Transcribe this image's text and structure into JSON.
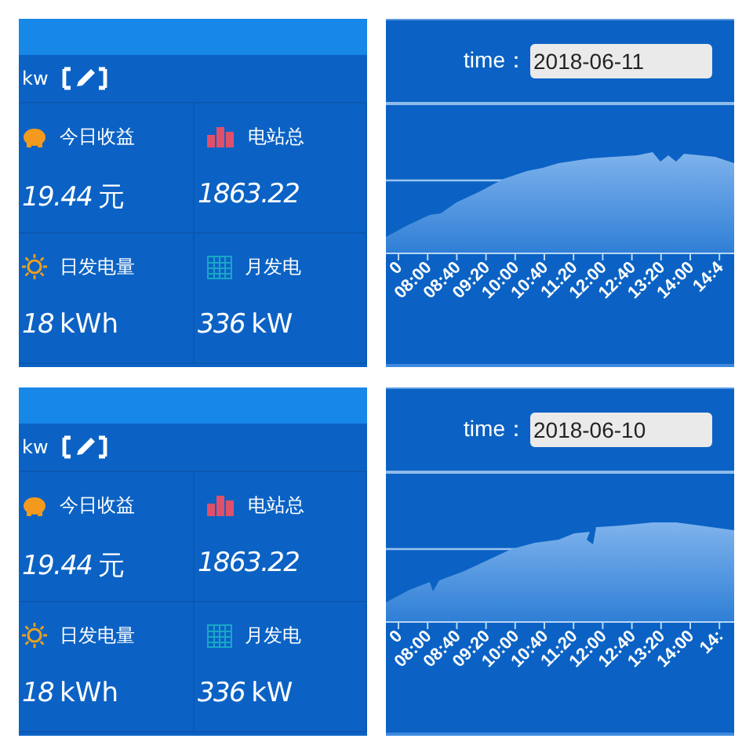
{
  "panels": [
    {
      "kind": "stats",
      "power_unit": "kw",
      "stats": [
        {
          "label": "今日收益",
          "value": "19.44",
          "unit": "元"
        },
        {
          "label": "电站总",
          "value": "1863.22"
        },
        {
          "label": "日发电量",
          "value": "18",
          "unit": "kWh"
        },
        {
          "label": "月发电",
          "value": "336",
          "unit": "kW"
        }
      ]
    },
    {
      "kind": "chart",
      "time_label": "time：",
      "date": "2018-06-11",
      "x_tick_labels": [
        "0",
        "08:00",
        "08:40",
        "09:20",
        "10:00",
        "10:40",
        "11:20",
        "12:00",
        "12:40",
        "13:20",
        "14:00",
        "14:4"
      ]
    },
    {
      "kind": "stats",
      "power_unit": "kw",
      "stats": [
        {
          "label": "今日收益",
          "value": "19.44",
          "unit": "元"
        },
        {
          "label": "电站总",
          "value": "1863.22"
        },
        {
          "label": "日发电量",
          "value": "18",
          "unit": "kWh"
        },
        {
          "label": "月发电",
          "value": "336",
          "unit": "kW"
        }
      ]
    },
    {
      "kind": "chart",
      "time_label": "time：",
      "date": "2018-06-10",
      "x_tick_labels": [
        "0",
        "08:00",
        "08:40",
        "09:20",
        "10:00",
        "10:40",
        "11:20",
        "12:00",
        "12:40",
        "13:20",
        "14:00",
        "14:"
      ]
    }
  ]
}
